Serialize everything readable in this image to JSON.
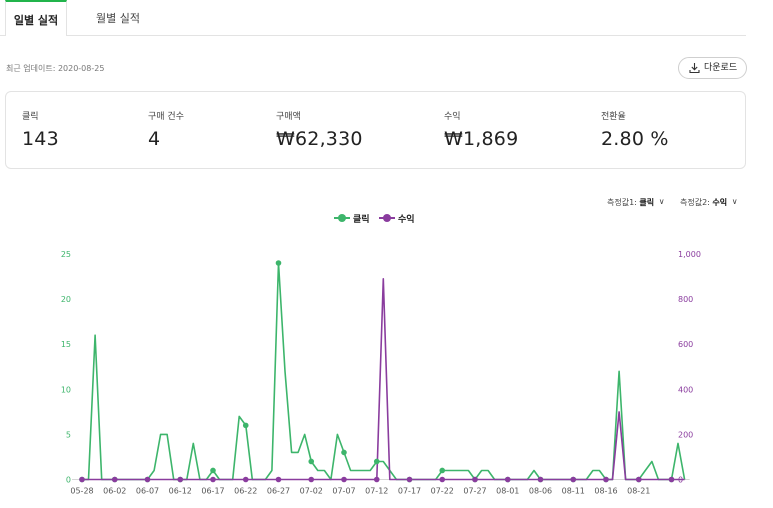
{
  "tabs": {
    "daily": "일별 실적",
    "monthly": "월별 실적"
  },
  "updated_text": "최근 업데이트: 2020-08-25",
  "download_label": "다운로드",
  "summary": [
    {
      "label": "클릭",
      "value": "143"
    },
    {
      "label": "구매 건수",
      "value": "4"
    },
    {
      "label": "구매액",
      "value": "₩62,330"
    },
    {
      "label": "수익",
      "value": "₩1,869"
    },
    {
      "label": "전환율",
      "value": "2.80 %"
    }
  ],
  "selectors": {
    "metric1_label": "측정값1:",
    "metric1_value": "클릭",
    "metric2_label": "측정값2:",
    "metric2_value": "수익"
  },
  "colors": {
    "clicks": "#3db56b",
    "revenue": "#8a3c9e",
    "accent": "#21b44b"
  },
  "chart_data": {
    "type": "line",
    "legend_position": "top-center",
    "x_tick_labels": [
      "05-28",
      "06-02",
      "06-07",
      "06-12",
      "06-17",
      "06-22",
      "06-27",
      "07-02",
      "07-07",
      "07-12",
      "07-17",
      "07-22",
      "07-27",
      "08-01",
      "08-06",
      "08-11",
      "08-16",
      "08-21"
    ],
    "y_left": {
      "ticks": [
        "0",
        "5",
        "10",
        "15",
        "20",
        "25"
      ],
      "range": [
        0,
        25
      ]
    },
    "y_right": {
      "ticks": [
        "0",
        "200",
        "400",
        "600",
        "800",
        "1,000"
      ],
      "range": [
        0,
        1000
      ]
    },
    "x_start": "2020-05-28",
    "series": [
      {
        "name": "클릭",
        "axis": "left",
        "values": [
          0,
          0,
          16,
          0,
          0,
          0,
          0,
          0,
          0,
          0,
          0,
          1,
          5,
          5,
          0,
          0,
          0,
          4,
          0,
          0,
          1,
          0,
          0,
          0,
          7,
          6,
          0,
          0,
          0,
          1,
          24,
          12,
          3,
          3,
          5,
          2,
          1,
          1,
          0,
          5,
          3,
          1,
          1,
          1,
          1,
          2,
          2,
          1,
          0,
          0,
          0,
          0,
          0,
          0,
          0,
          1,
          1,
          1,
          1,
          1,
          0,
          1,
          1,
          0,
          0,
          0,
          0,
          0,
          0,
          1,
          0,
          0,
          0,
          0,
          0,
          0,
          0,
          0,
          1,
          1,
          0,
          0,
          12,
          0,
          0,
          0,
          1,
          2,
          0,
          0,
          0,
          4,
          0
        ]
      },
      {
        "name": "수익",
        "axis": "right",
        "values": [
          0,
          0,
          0,
          0,
          0,
          0,
          0,
          0,
          0,
          0,
          0,
          0,
          0,
          0,
          0,
          0,
          0,
          0,
          0,
          0,
          0,
          0,
          0,
          0,
          0,
          0,
          0,
          0,
          0,
          0,
          0,
          0,
          0,
          0,
          0,
          0,
          0,
          0,
          0,
          0,
          0,
          0,
          0,
          0,
          0,
          0,
          890,
          0,
          0,
          0,
          0,
          0,
          0,
          0,
          0,
          0,
          0,
          0,
          0,
          0,
          0,
          0,
          0,
          0,
          0,
          0,
          0,
          0,
          0,
          0,
          0,
          0,
          0,
          0,
          0,
          0,
          0,
          0,
          0,
          0,
          0,
          0,
          300,
          0,
          0,
          0,
          0,
          0,
          0,
          0,
          0,
          0,
          0
        ]
      }
    ],
    "markers": {
      "clicks_idx": [
        0,
        5,
        10,
        15,
        20,
        25,
        30,
        35,
        40,
        45,
        50,
        55,
        60,
        65,
        70,
        75,
        80,
        85,
        90
      ],
      "revenue_idx": [
        0,
        5,
        10,
        15,
        20,
        25,
        30,
        35,
        40,
        45,
        50,
        55,
        60,
        65,
        70,
        75,
        80,
        85,
        90
      ]
    }
  }
}
